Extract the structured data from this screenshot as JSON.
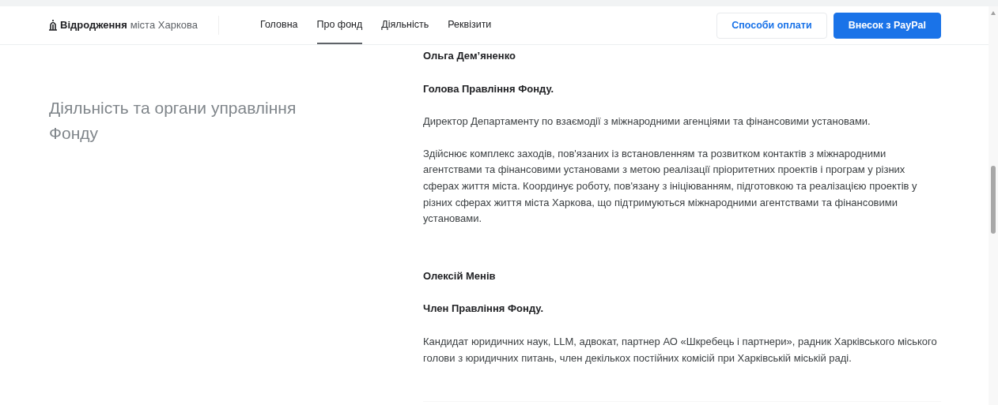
{
  "header": {
    "logo": {
      "strong": "Відродження",
      "light": "міста Харкова"
    },
    "nav": [
      {
        "label": "Головна",
        "selected": false
      },
      {
        "label": "Про фонд",
        "selected": true
      },
      {
        "label": "Діяльність",
        "selected": false
      },
      {
        "label": "Реквізити",
        "selected": false
      }
    ],
    "buttons": [
      {
        "label": "Способи оплати",
        "kind": "outline"
      },
      {
        "label": "Внесок з PayPal",
        "kind": "primary"
      }
    ]
  },
  "section_title": "Діяльність та органи управління Фонду",
  "members": [
    {
      "name": "Ольга Дем’яненко",
      "role": "Голова Правління Фонду.",
      "paragraphs": [
        "Директор Департаменту по взаємодії з міжнародними агенціями та фінансовими установами.",
        "Здійснює комплекс заходів, пов'язаних із встановленням та розвитком контактів з міжнародними агентствами та фінансовими установами з метою реалізації пріоритетних проектів і програм у різних сферах життя міста.  Координує роботу, пов'язану з ініціюванням, підготовкою та реалізацією проектів у різних сферах життя міста Харкова, що підтримуються міжнародними агентствами та фінансовими установами."
      ]
    },
    {
      "name": "Олексій Менів",
      "role": "Член Правління Фонду.",
      "paragraphs": [
        "Кандидат юридичних наук, LLM, адвокат, партнер АО «Шкребець і партнери», радник Харківського міського голови з юридичних питань, член декількох постійних комісій при Харківській міській раді."
      ]
    }
  ]
}
